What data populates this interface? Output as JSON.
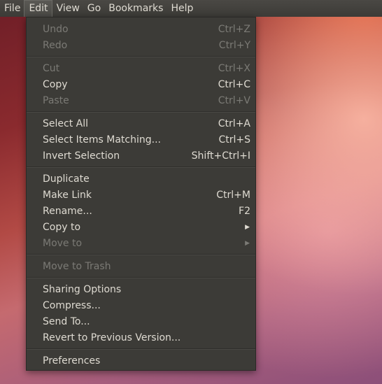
{
  "menubar": {
    "items": [
      {
        "label": "File"
      },
      {
        "label": "Edit"
      },
      {
        "label": "View"
      },
      {
        "label": "Go"
      },
      {
        "label": "Bookmarks"
      },
      {
        "label": "Help"
      }
    ]
  },
  "edit_menu": {
    "undo": {
      "label": "Undo",
      "accel": "Ctrl+Z"
    },
    "redo": {
      "label": "Redo",
      "accel": "Ctrl+Y"
    },
    "cut": {
      "label": "Cut",
      "accel": "Ctrl+X"
    },
    "copy": {
      "label": "Copy",
      "accel": "Ctrl+C"
    },
    "paste": {
      "label": "Paste",
      "accel": "Ctrl+V"
    },
    "select_all": {
      "label": "Select All",
      "accel": "Ctrl+A"
    },
    "select_items_matching": {
      "label": "Select Items Matching...",
      "accel": "Ctrl+S"
    },
    "invert_selection": {
      "label": "Invert Selection",
      "accel": "Shift+Ctrl+I"
    },
    "duplicate": {
      "label": "Duplicate"
    },
    "make_link": {
      "label": "Make Link",
      "accel": "Ctrl+M"
    },
    "rename": {
      "label": "Rename...",
      "accel": "F2"
    },
    "copy_to": {
      "label": "Copy to",
      "arrow": "▶"
    },
    "move_to": {
      "label": "Move to",
      "arrow": "▶"
    },
    "move_to_trash": {
      "label": "Move to Trash"
    },
    "sharing_options": {
      "label": "Sharing Options"
    },
    "compress": {
      "label": "Compress..."
    },
    "send_to": {
      "label": "Send To..."
    },
    "revert": {
      "label": "Revert to Previous Version..."
    },
    "preferences": {
      "label": "Preferences"
    }
  }
}
